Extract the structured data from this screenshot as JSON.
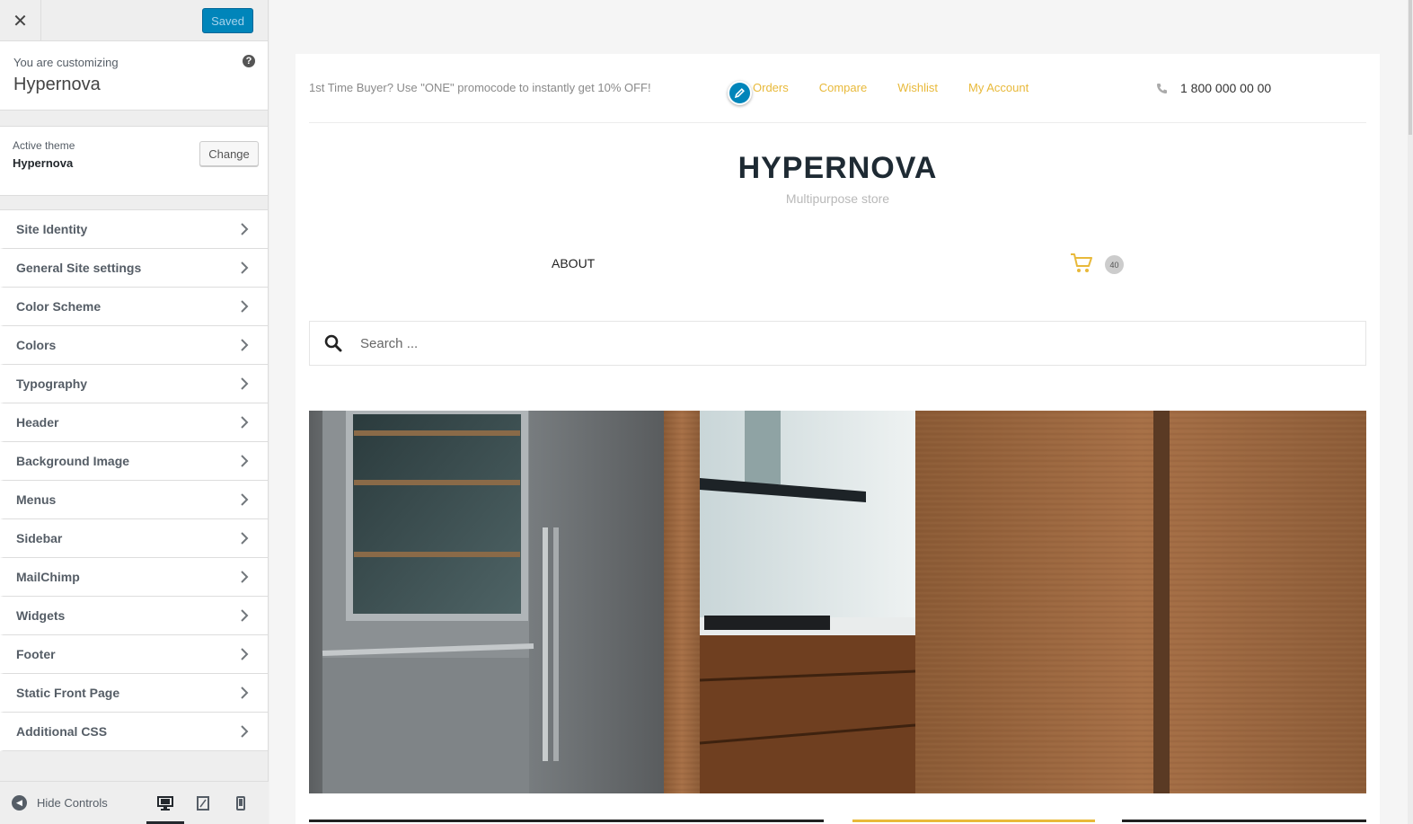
{
  "customizer": {
    "close_icon": "close-icon",
    "saved_label": "Saved",
    "customizing_label": "You are customizing",
    "site_name": "Hypernova",
    "active_theme_label": "Active theme",
    "active_theme_name": "Hypernova",
    "change_label": "Change",
    "panels": [
      {
        "label": "Site Identity"
      },
      {
        "label": "General Site settings"
      },
      {
        "label": "Color Scheme"
      },
      {
        "label": "Colors"
      },
      {
        "label": "Typography"
      },
      {
        "label": "Header"
      },
      {
        "label": "Background Image"
      },
      {
        "label": "Menus"
      },
      {
        "label": "Sidebar"
      },
      {
        "label": "MailChimp"
      },
      {
        "label": "Widgets"
      },
      {
        "label": "Footer"
      },
      {
        "label": "Static Front Page"
      },
      {
        "label": "Additional CSS"
      }
    ],
    "hide_controls_label": "Hide Controls",
    "devices": [
      "desktop",
      "tablet",
      "mobile"
    ],
    "active_device": "desktop"
  },
  "preview": {
    "promo_text": "1st Time Buyer? Use \"ONE\" promocode to instantly get 10% OFF!",
    "top_links": [
      "Orders",
      "Compare",
      "Wishlist",
      "My Account"
    ],
    "phone": "1 800 000 00 00",
    "logo": "HYPERNOVA",
    "tagline": "Multipurpose store",
    "nav_about": "ABOUT",
    "cart_count": "40",
    "search_placeholder": "Search ...",
    "colors": {
      "accent": "#e8b93a",
      "wp_blue": "#0085ba",
      "logo_dark": "#1e2a33"
    }
  }
}
